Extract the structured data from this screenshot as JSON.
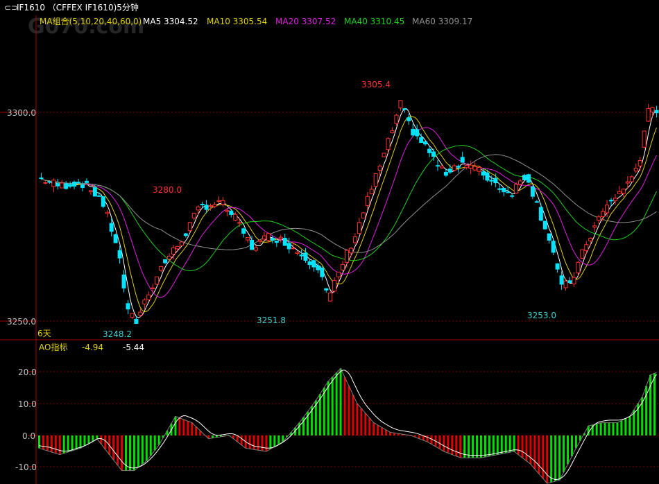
{
  "window": {
    "title": "IF1610 （CFFEX IF1610)5分钟",
    "icon": "window-menu-icon",
    "watermark": "G070.com"
  },
  "colors": {
    "up": "#ff3232",
    "down": "#00e5ff",
    "ma5": "#ffffff",
    "ma10": "#e0d000",
    "ma20": "#e020e0",
    "ma40": "#20d020",
    "ma60": "#909090",
    "grid": "#800000",
    "axis_text": "#c0c0c0",
    "ao_up": "#00e000",
    "ao_down": "#e00000"
  },
  "main_panel": {
    "legend": [
      {
        "label": "MA组合(5,10,20,40,60,0)",
        "color": "#e0d000"
      },
      {
        "label": "MA5 3304.52",
        "color": "#ffffff"
      },
      {
        "label": "MA10 3305.54",
        "color": "#e0d000"
      },
      {
        "label": "MA20 3307.52",
        "color": "#e020e0"
      },
      {
        "label": "MA40 3310.45",
        "color": "#20d020"
      },
      {
        "label": "MA60 3309.17",
        "color": "#909090"
      }
    ],
    "period_label": "6天",
    "y_ticks": [
      "3300.0",
      "3250.0"
    ],
    "annotations": [
      {
        "text": "3305.4",
        "price": 3305.4,
        "color": "#ff3232"
      },
      {
        "text": "3280.0",
        "price": 3280.0,
        "color": "#ff3232"
      },
      {
        "text": "3251.8",
        "price": 3251.8,
        "color": "#40d0d0"
      },
      {
        "text": "3248.2",
        "price": 3248.2,
        "color": "#40d0d0"
      },
      {
        "text": "3253.0",
        "price": 3253.0,
        "color": "#40d0d0"
      }
    ]
  },
  "ao_panel": {
    "title": "AO指标",
    "value1": "-4.94",
    "value2": "-5.44",
    "y_ticks": [
      "20.0",
      "10.0",
      "0.0",
      "-10.0"
    ]
  },
  "chart_data": {
    "type": "candlestick",
    "price_range": [
      3249,
      3300
    ],
    "ao_range": [
      -12,
      22
    ],
    "anchors": [
      [
        0,
        3284
      ],
      [
        10,
        3282
      ],
      [
        20,
        3283
      ],
      [
        30,
        3279
      ],
      [
        38,
        3267
      ],
      [
        43,
        3251
      ],
      [
        47,
        3249
      ],
      [
        52,
        3255
      ],
      [
        60,
        3263
      ],
      [
        68,
        3268
      ],
      [
        78,
        3277
      ],
      [
        88,
        3278
      ],
      [
        95,
        3274
      ],
      [
        103,
        3267
      ],
      [
        112,
        3270
      ],
      [
        120,
        3268
      ],
      [
        128,
        3265
      ],
      [
        136,
        3262
      ],
      [
        140,
        3254
      ],
      [
        146,
        3262
      ],
      [
        153,
        3270
      ],
      [
        160,
        3280
      ],
      [
        168,
        3291
      ],
      [
        175,
        3302
      ],
      [
        180,
        3296
      ],
      [
        188,
        3291
      ],
      [
        196,
        3285
      ],
      [
        204,
        3288
      ],
      [
        212,
        3286
      ],
      [
        220,
        3283
      ],
      [
        228,
        3280
      ],
      [
        236,
        3285
      ],
      [
        242,
        3276
      ],
      [
        248,
        3268
      ],
      [
        253,
        3257
      ],
      [
        258,
        3259
      ],
      [
        265,
        3268
      ],
      [
        272,
        3275
      ],
      [
        280,
        3280
      ],
      [
        286,
        3283
      ],
      [
        291,
        3289
      ],
      [
        295,
        3300
      ],
      [
        300,
        3301
      ]
    ],
    "ao_anchors": [
      [
        0,
        -4
      ],
      [
        10,
        -6
      ],
      [
        20,
        -4
      ],
      [
        28,
        -1
      ],
      [
        34,
        -6
      ],
      [
        40,
        -11
      ],
      [
        46,
        -11
      ],
      [
        52,
        -8
      ],
      [
        58,
        -3
      ],
      [
        66,
        6
      ],
      [
        74,
        4
      ],
      [
        82,
        -1
      ],
      [
        92,
        0
      ],
      [
        100,
        -4
      ],
      [
        110,
        -5
      ],
      [
        118,
        -2
      ],
      [
        126,
        4
      ],
      [
        134,
        11
      ],
      [
        140,
        17
      ],
      [
        146,
        21
      ],
      [
        154,
        10
      ],
      [
        162,
        4
      ],
      [
        170,
        1
      ],
      [
        180,
        0
      ],
      [
        188,
        -2
      ],
      [
        196,
        -5
      ],
      [
        204,
        -7
      ],
      [
        214,
        -7
      ],
      [
        222,
        -6
      ],
      [
        230,
        -5
      ],
      [
        238,
        -9
      ],
      [
        246,
        -15
      ],
      [
        252,
        -14
      ],
      [
        260,
        -4
      ],
      [
        266,
        3
      ],
      [
        272,
        4
      ],
      [
        280,
        4
      ],
      [
        286,
        6
      ],
      [
        292,
        12
      ],
      [
        296,
        19
      ],
      [
        300,
        20
      ]
    ]
  }
}
